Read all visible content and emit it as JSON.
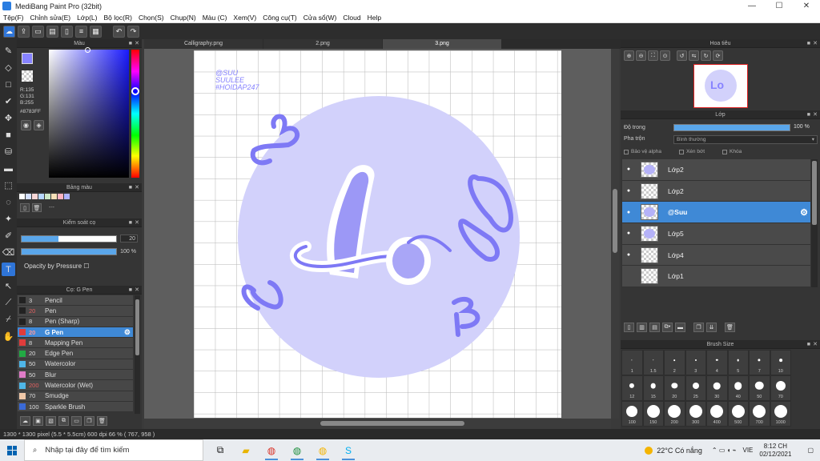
{
  "window": {
    "title": "MediBang Paint Pro (32bit)",
    "minimize": "—",
    "maximize": "☐",
    "close": "✕"
  },
  "menu": [
    "Tệp(F)",
    "Chỉnh sửa(E)",
    "Lớp(L)",
    "Bộ lọc(R)",
    "Chọn(S)",
    "Chụp(N)",
    "Màu (C)",
    "Xem(V)",
    "Công cụ(T)",
    "Cửa sổ(W)",
    "Cloud",
    "Help"
  ],
  "tabs": [
    "Calligraphy.png",
    "2.png",
    "3.png"
  ],
  "color_panel": {
    "title": "Màu",
    "rgb": "R:135\nG:131\nB:255",
    "hex": "#8783FF",
    "primary": "#8783ff"
  },
  "palette_panel": {
    "title": "Bảng màu",
    "swatches": [
      "#ffffff",
      "#d4e0ff",
      "#f6d6d6",
      "#b8d8ff",
      "#cde8c8",
      "#f6e0b8",
      "#ffb3c1",
      "#aeb4ff"
    ],
    "more": "---"
  },
  "brush_control": {
    "title": "Kiểm soát cọ",
    "size_value": "20",
    "size_fill": 0.39,
    "opacity_value": "100 %",
    "opacity_fill": 1.0,
    "pressure_label": "Opacity by Pressure"
  },
  "brush_panel": {
    "title": "Cọ: G Pen",
    "items": [
      {
        "size": "3",
        "name": "Pencil",
        "color": "#222222",
        "size_color": "#dddddd"
      },
      {
        "size": "20",
        "name": "Pen",
        "color": "#222222",
        "size_color": "#e06060"
      },
      {
        "size": "8",
        "name": "Pen (Sharp)",
        "color": "#222222",
        "size_color": "#dddddd"
      },
      {
        "size": "20",
        "name": "G Pen",
        "color": "#e03c3c",
        "size_color": "#e06060",
        "active": true
      },
      {
        "size": "8",
        "name": "Mapping Pen",
        "color": "#e03c3c",
        "size_color": "#dddddd"
      },
      {
        "size": "20",
        "name": "Edge Pen",
        "color": "#22aa44",
        "size_color": "#dddddd"
      },
      {
        "size": "50",
        "name": "Watercolor",
        "color": "#4fb6e8",
        "size_color": "#dddddd"
      },
      {
        "size": "50",
        "name": "Blur",
        "color": "#e07cc8",
        "size_color": "#dddddd"
      },
      {
        "size": "200",
        "name": "Watercolor (Wet)",
        "color": "#4fb6e8",
        "size_color": "#e06060"
      },
      {
        "size": "70",
        "name": "Smudge",
        "color": "#f0c8a8",
        "size_color": "#dddddd"
      },
      {
        "size": "100",
        "name": "Sparkle Brush",
        "color": "#3a6ad8",
        "size_color": "#dddddd"
      }
    ]
  },
  "navigator": {
    "title": "Hoa tiêu"
  },
  "layer_panel": {
    "title": "Lớp",
    "opacity_label": "Độ trong",
    "opacity_value": "100 %",
    "blend_label": "Pha trộn",
    "blend_value": "Bình thường",
    "protect_alpha": "Bảo vệ alpha",
    "clipping": "Xén bớt",
    "lock": "Khóa",
    "layers": [
      {
        "name": "Lớp2",
        "visible": true
      },
      {
        "name": "Lớp2",
        "visible": true
      },
      {
        "name": "@Suu",
        "visible": true,
        "active": true
      },
      {
        "name": "Lớp5",
        "visible": true
      },
      {
        "name": "Lớp4",
        "visible": true
      },
      {
        "name": "Lớp1",
        "visible": false
      }
    ]
  },
  "brush_size_panel": {
    "title": "Brush Size",
    "sizes": [
      "1",
      "1.5",
      "2",
      "3",
      "4",
      "5",
      "7",
      "10",
      "12",
      "15",
      "20",
      "25",
      "30",
      "40",
      "50",
      "70",
      "100",
      "150",
      "200",
      "300",
      "400",
      "500",
      "700",
      "1000"
    ]
  },
  "canvas_art": {
    "signature_lines": [
      "@SUU",
      "SUULEE",
      "#HOIDAP247"
    ],
    "circle_color": "#d2d1fb",
    "stroke_color": "#7e79f5"
  },
  "status": "1300 * 1300 pixel  (5.5 * 5.5cm)  600 dpi  66 %  ( 767, 958 )",
  "taskbar": {
    "search_placeholder": "Nhập tại đây để tìm kiếm",
    "weather": "22°C  Có nắng",
    "lang": "VIE",
    "time": "8:12 CH",
    "date": "02/12/2021"
  }
}
